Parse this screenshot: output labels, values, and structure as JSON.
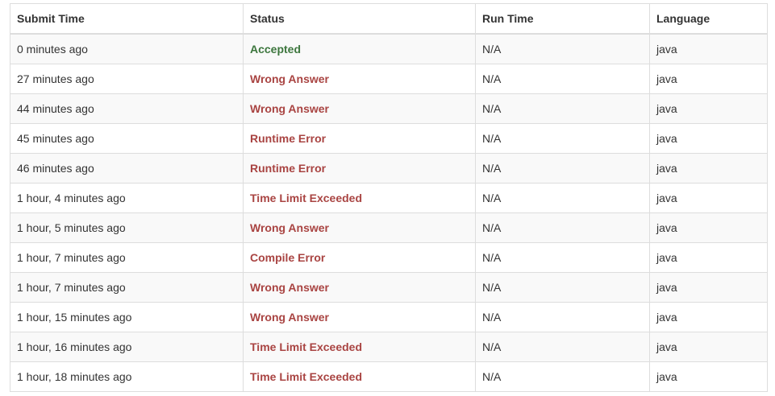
{
  "table": {
    "headers": {
      "submit_time": "Submit Time",
      "status": "Status",
      "run_time": "Run Time",
      "language": "Language"
    },
    "rows": [
      {
        "submit_time": "0 minutes ago",
        "status": "Accepted",
        "status_kind": "accepted",
        "run_time": "N/A",
        "language": "java"
      },
      {
        "submit_time": "27 minutes ago",
        "status": "Wrong Answer",
        "status_kind": "rejected",
        "run_time": "N/A",
        "language": "java"
      },
      {
        "submit_time": "44 minutes ago",
        "status": "Wrong Answer",
        "status_kind": "rejected",
        "run_time": "N/A",
        "language": "java"
      },
      {
        "submit_time": "45 minutes ago",
        "status": "Runtime Error",
        "status_kind": "rejected",
        "run_time": "N/A",
        "language": "java"
      },
      {
        "submit_time": "46 minutes ago",
        "status": "Runtime Error",
        "status_kind": "rejected",
        "run_time": "N/A",
        "language": "java"
      },
      {
        "submit_time": "1 hour, 4 minutes ago",
        "status": "Time Limit Exceeded",
        "status_kind": "rejected",
        "run_time": "N/A",
        "language": "java"
      },
      {
        "submit_time": "1 hour, 5 minutes ago",
        "status": "Wrong Answer",
        "status_kind": "rejected",
        "run_time": "N/A",
        "language": "java"
      },
      {
        "submit_time": "1 hour, 7 minutes ago",
        "status": "Compile Error",
        "status_kind": "rejected",
        "run_time": "N/A",
        "language": "java"
      },
      {
        "submit_time": "1 hour, 7 minutes ago",
        "status": "Wrong Answer",
        "status_kind": "rejected",
        "run_time": "N/A",
        "language": "java"
      },
      {
        "submit_time": "1 hour, 15 minutes ago",
        "status": "Wrong Answer",
        "status_kind": "rejected",
        "run_time": "N/A",
        "language": "java"
      },
      {
        "submit_time": "1 hour, 16 minutes ago",
        "status": "Time Limit Exceeded",
        "status_kind": "rejected",
        "run_time": "N/A",
        "language": "java"
      },
      {
        "submit_time": "1 hour, 18 minutes ago",
        "status": "Time Limit Exceeded",
        "status_kind": "rejected",
        "run_time": "N/A",
        "language": "java"
      }
    ]
  },
  "colors": {
    "accepted": "#3c763d",
    "rejected": "#a94442",
    "border": "#dddddd",
    "stripe": "#f9f9f9"
  }
}
